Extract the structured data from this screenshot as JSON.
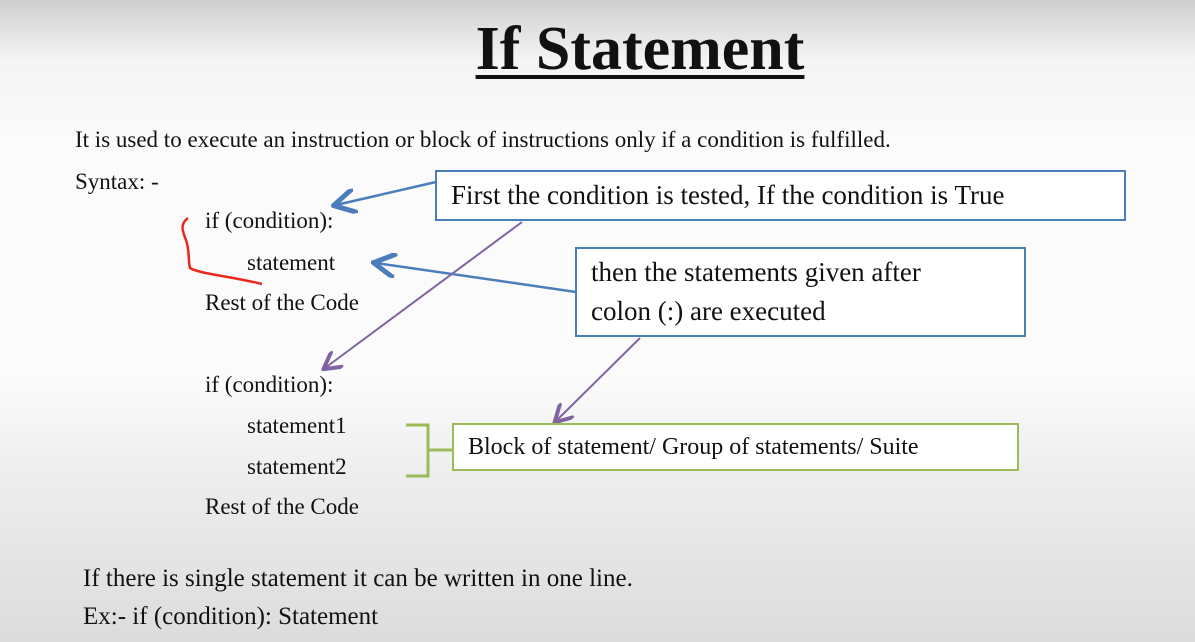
{
  "slide": {
    "title": "If Statement",
    "description": "It is used to execute an instruction or block of instructions only if a condition is fulfilled.",
    "syntax_label": "Syntax: -",
    "example1": {
      "line1": "if (condition):",
      "line2": "statement",
      "line3": "Rest of the Code"
    },
    "example2": {
      "line1": "if (condition):",
      "line2": "statement1",
      "line3": "statement2",
      "line4": "Rest of the Code"
    },
    "callouts": {
      "first": "First the condition is tested, If the condition is True",
      "then_line1": "then the statements given after",
      "then_line2": "colon (:) are executed",
      "block": "Block of statement/ Group of statements/ Suite"
    },
    "note_line1": "If there is single statement it can be written in one line.",
    "note_line2": "Ex:- if (condition): Statement"
  },
  "colors": {
    "blue": "#4a7ebb",
    "purple": "#8064a2",
    "green": "#9bbb59",
    "red": "#e8281c"
  }
}
